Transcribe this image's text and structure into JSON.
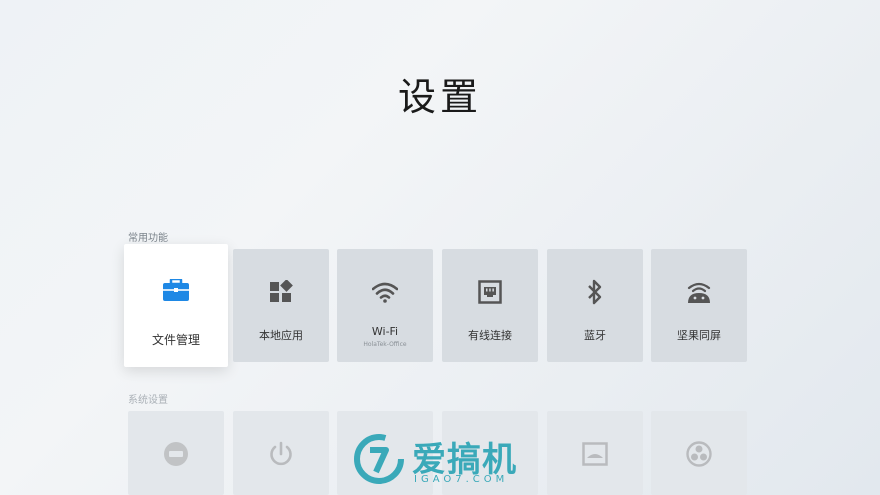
{
  "page": {
    "title": "设置"
  },
  "sections": {
    "common": {
      "label": "常用功能",
      "tiles": [
        {
          "label": "文件管理",
          "icon": "briefcase-icon",
          "accent": "#1e88e5"
        },
        {
          "label": "本地应用",
          "icon": "apps-icon"
        },
        {
          "label": "Wi-Fi",
          "sub": "HolaTek-Office",
          "icon": "wifi-icon"
        },
        {
          "label": "有线连接",
          "icon": "ethernet-icon"
        },
        {
          "label": "蓝牙",
          "icon": "bluetooth-icon"
        },
        {
          "label": "坚果同屏",
          "icon": "screen-mirror-icon"
        }
      ]
    },
    "system": {
      "label": "系统设置",
      "tiles": [
        {
          "icon": "hdmi-icon"
        },
        {
          "icon": "power-icon"
        },
        {
          "icon": "unknown-icon"
        },
        {
          "icon": "unknown-icon"
        },
        {
          "icon": "picture-icon"
        },
        {
          "icon": "fan-icon"
        }
      ]
    }
  },
  "watermark": {
    "text": "爱搞机",
    "sub": "IGAO7.COM",
    "color": "#3aa9b9"
  }
}
